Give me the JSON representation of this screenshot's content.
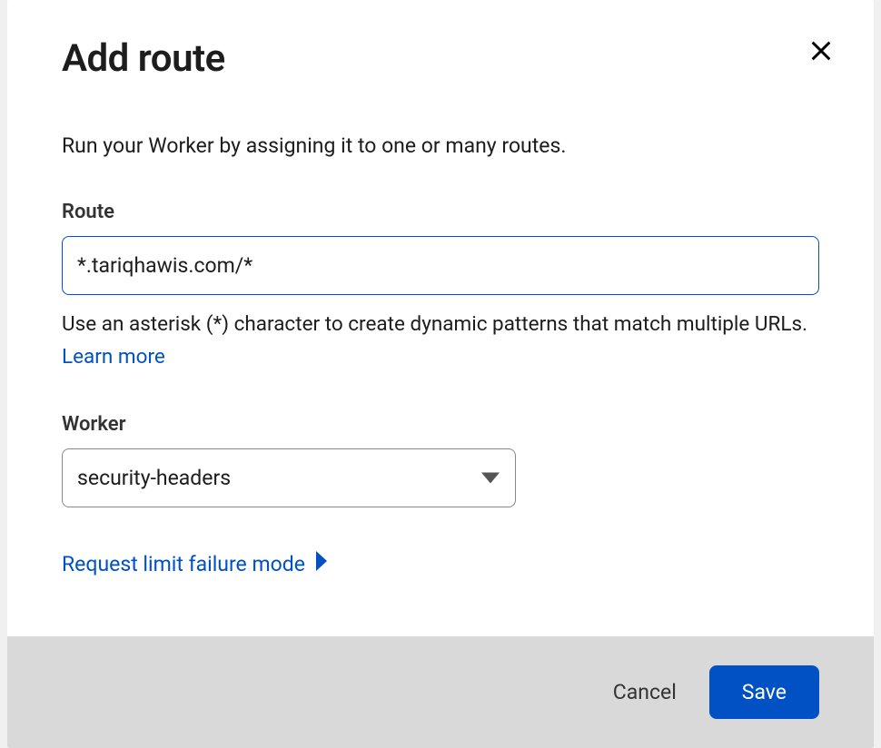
{
  "modal": {
    "title": "Add route",
    "description": "Run your Worker by assigning it to one or many routes.",
    "route": {
      "label": "Route",
      "value": "*.tariqhawis.com/*",
      "helper": "Use an asterisk (*) character to create dynamic patterns that match multiple URLs. ",
      "learn_more": "Learn more"
    },
    "worker": {
      "label": "Worker",
      "selected": "security-headers"
    },
    "expand_link": "Request limit failure mode",
    "footer": {
      "cancel": "Cancel",
      "save": "Save"
    }
  }
}
